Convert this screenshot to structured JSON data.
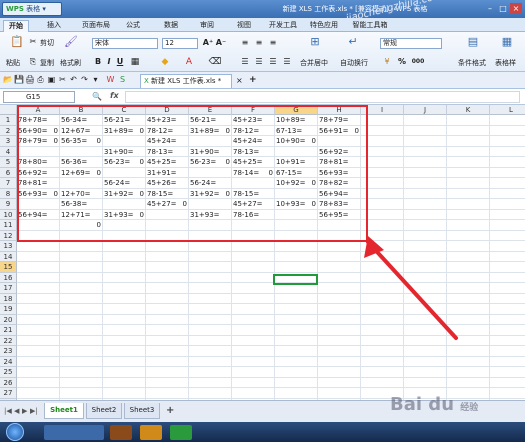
{
  "app": {
    "logo": "WPS",
    "menu_label": "表格",
    "window_title": "新建 XLS 工作表.xls * [兼容模式] - WPS 表格"
  },
  "watermark": "jiaochengzhijia.com",
  "window_controls": {
    "minimize": "–",
    "maximize": "□",
    "close": "×"
  },
  "menu_tabs": [
    "开始",
    "插入",
    "页面布局",
    "公式",
    "数据",
    "审阅",
    "视图",
    "开发工具",
    "特色应用",
    "智能工具箱"
  ],
  "ribbon": {
    "cut": "剪切",
    "paste": "粘贴",
    "copy": "复制",
    "format_painter": "格式刷",
    "font_name": "宋体",
    "font_size": "12",
    "bold": "B",
    "italic": "I",
    "underline": "U",
    "grow": "A⁺",
    "shrink": "A⁻",
    "merge_center": "合并居中",
    "wrap_text": "自动换行",
    "number_format": "常规",
    "percent": "%",
    "comma": "000",
    "conditional_format": "条件格式",
    "table_style": "表格样"
  },
  "doc_tab": {
    "prefix": "X",
    "name": "新建 XLS 工作表.xls *"
  },
  "formula_bar": {
    "name_box": "G15",
    "fx": "fx"
  },
  "columns": [
    "A",
    "B",
    "C",
    "D",
    "E",
    "F",
    "G",
    "H",
    "I",
    "J",
    "K",
    "L"
  ],
  "active_column": "G",
  "rows": [
    "1",
    "2",
    "3",
    "4",
    "5",
    "6",
    "7",
    "8",
    "9",
    "10",
    "11",
    "12",
    "13",
    "14",
    "15",
    "16",
    "17",
    "18",
    "19",
    "20",
    "21",
    "22",
    "23",
    "24",
    "25",
    "26",
    "27",
    "28"
  ],
  "active_row": "15",
  "cells": [
    [
      "78+78=",
      "56-34=",
      "56-21=",
      "45+23=",
      "56-21=",
      "45+23=",
      "10+89=",
      "78+79="
    ],
    [
      "56+90=",
      "12+67=",
      "31+89=",
      "78-12=",
      "31+89=",
      "78-12=",
      "67-13=",
      "56+91="
    ],
    [
      "78+79=",
      "56-35=",
      "",
      "45+24=",
      "",
      "45+24=",
      "10+90=",
      ""
    ],
    [
      "",
      "",
      "31+90=",
      "78-13=",
      "31+90=",
      "78-13=",
      "",
      "56+92="
    ],
    [
      "78+80=",
      "56-36=",
      "56-23=",
      "45+25=",
      "56-23=",
      "45+25=",
      "10+91=",
      "78+81="
    ],
    [
      "56+92=",
      "12+69=",
      "",
      "31+91=",
      "",
      "78-14=",
      "67-15=",
      "56+93="
    ],
    [
      "78+81=",
      "",
      "56-24=",
      "45+26=",
      "56-24=",
      "",
      "10+92=",
      "78+82="
    ],
    [
      "56+93=",
      "12+70=",
      "31+92=",
      "78-15=",
      "31+92=",
      "78-15=",
      "",
      "56+94="
    ],
    [
      "",
      "56-38=",
      "",
      "45+27=",
      "",
      "45+27=",
      "10+93=",
      "78+83="
    ],
    [
      "56+94=",
      "12+71=",
      "31+93=",
      "",
      "31+93=",
      "78-16=",
      "",
      "56+95="
    ],
    [
      "",
      "",
      "",
      "",
      "",
      "",
      "",
      ""
    ],
    [
      "",
      "",
      "",
      "",
      "",
      "",
      "",
      ""
    ]
  ],
  "zeros": [
    {
      "r": 2,
      "c": 1,
      "v": "0"
    },
    {
      "r": 2,
      "c": 3,
      "v": "0"
    },
    {
      "r": 2,
      "c": 5,
      "v": "0"
    },
    {
      "r": 2,
      "c": 8,
      "v": "0"
    },
    {
      "r": 3,
      "c": 1,
      "v": "0"
    },
    {
      "r": 3,
      "c": 2,
      "v": "0"
    },
    {
      "r": 3,
      "c": 7,
      "v": "0"
    },
    {
      "r": 5,
      "c": 3,
      "v": "0"
    },
    {
      "r": 5,
      "c": 5,
      "v": "0"
    },
    {
      "r": 6,
      "c": 2,
      "v": "0"
    },
    {
      "r": 6,
      "c": 6,
      "v": "0"
    },
    {
      "r": 7,
      "c": 7,
      "v": "0"
    },
    {
      "r": 8,
      "c": 1,
      "v": "0"
    },
    {
      "r": 8,
      "c": 3,
      "v": "0"
    },
    {
      "r": 8,
      "c": 5,
      "v": "0"
    },
    {
      "r": 9,
      "c": 4,
      "v": "0"
    },
    {
      "r": 9,
      "c": 7,
      "v": "0"
    },
    {
      "r": 10,
      "c": 3,
      "v": "0"
    },
    {
      "r": 11,
      "c": 2,
      "v": "0"
    }
  ],
  "sheets": [
    "Sheet1",
    "Sheet2",
    "Sheet3"
  ],
  "sheet_add": "+",
  "sheet_nav": [
    "|◀",
    "◀",
    "▶",
    "▶|"
  ],
  "baidu": {
    "logo": "Bai du",
    "sub": "经验"
  },
  "taskbar": {
    "items": [
      "",
      "",
      "",
      ""
    ]
  },
  "colors": {
    "highlight": "#e4262e",
    "selection": "#1f9b39",
    "active_header": "#f7d58a"
  }
}
